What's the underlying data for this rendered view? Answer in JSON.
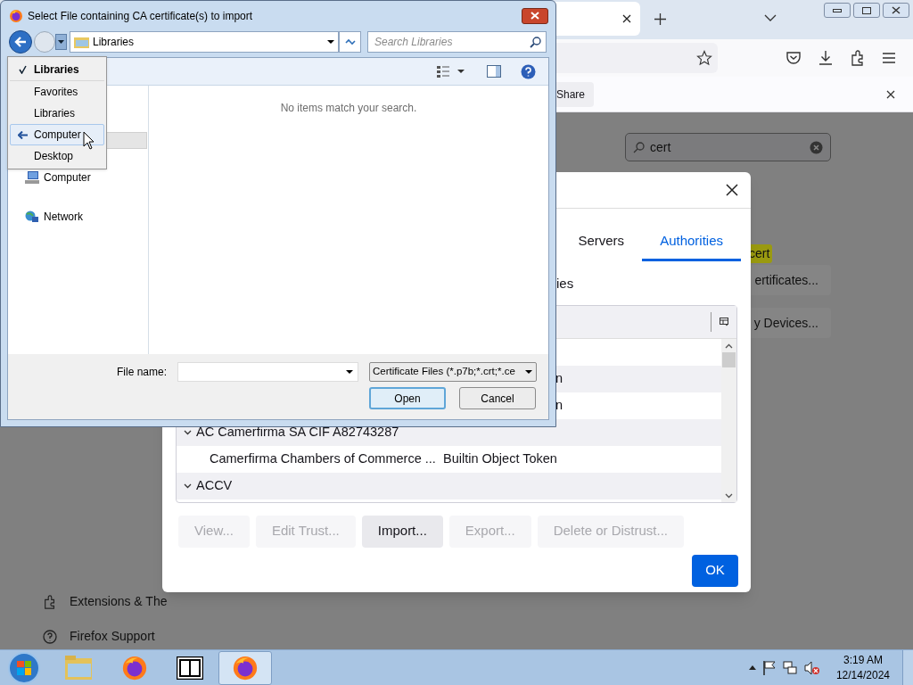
{
  "browser": {
    "notification": {
      "button": "Share"
    },
    "search": {
      "value": "cert"
    },
    "highlight": "cert",
    "buttons": [
      "ertificates...",
      "y Devices..."
    ],
    "sidebar": [
      {
        "kind": "puzzle",
        "label": "Extensions & The"
      },
      {
        "kind": "help",
        "label": "Firefox Support"
      }
    ]
  },
  "cert_dialog": {
    "tabs": [
      {
        "label": "Servers",
        "selected": false
      },
      {
        "label": "Authorities",
        "selected": true
      }
    ],
    "caption": "ies",
    "rows": [
      {
        "kind": "fragment",
        "text": "n"
      },
      {
        "kind": "fragment",
        "text": "n"
      },
      {
        "kind": "group",
        "text": "AC Camerfirma SA CIF A82743287",
        "expanded": true
      },
      {
        "kind": "cert",
        "text": "Camerfirma Chambers of Commerce ...",
        "token": "Builtin Object Token"
      },
      {
        "kind": "group",
        "text": "ACCV",
        "expanded": true
      }
    ],
    "buttons": [
      {
        "label": "View...",
        "disabled": true
      },
      {
        "label": "Edit Trust...",
        "disabled": true
      },
      {
        "label": "Import...",
        "disabled": false
      },
      {
        "label": "Export...",
        "disabled": true
      },
      {
        "label": "Delete or Distrust...",
        "disabled": true
      }
    ],
    "ok": "OK"
  },
  "file_dialog": {
    "title": "Select File containing CA certificate(s) to import",
    "address": "Libraries",
    "search": {
      "placeholder": "Search Libraries"
    },
    "nav": [
      {
        "kind": "computer",
        "label": "Computer"
      },
      {
        "kind": "network",
        "label": "Network"
      }
    ],
    "empty_message": "No items match your search.",
    "file_name_label": "File name:",
    "file_type": "Certificate Files (*.p7b;*.crt;*.ce",
    "buttons": [
      {
        "label": "Open",
        "default": true
      },
      {
        "label": "Cancel",
        "default": false
      }
    ]
  },
  "history_menu": [
    {
      "kind": "current",
      "label": "Libraries",
      "selected": false
    },
    {
      "kind": "item",
      "label": "Favorites",
      "selected": false
    },
    {
      "kind": "item",
      "label": "Libraries",
      "selected": false
    },
    {
      "kind": "back",
      "label": "Computer",
      "selected": true
    },
    {
      "kind": "item",
      "label": "Desktop",
      "selected": false
    }
  ],
  "taskbar": {
    "apps": [
      {
        "kind": "explorer",
        "selected": false
      },
      {
        "kind": "firefox",
        "selected": false
      },
      {
        "kind": "sevenzip",
        "selected": false
      },
      {
        "kind": "firefox",
        "selected": true
      }
    ],
    "time": "3:19 AM",
    "date": "12/14/2024"
  }
}
